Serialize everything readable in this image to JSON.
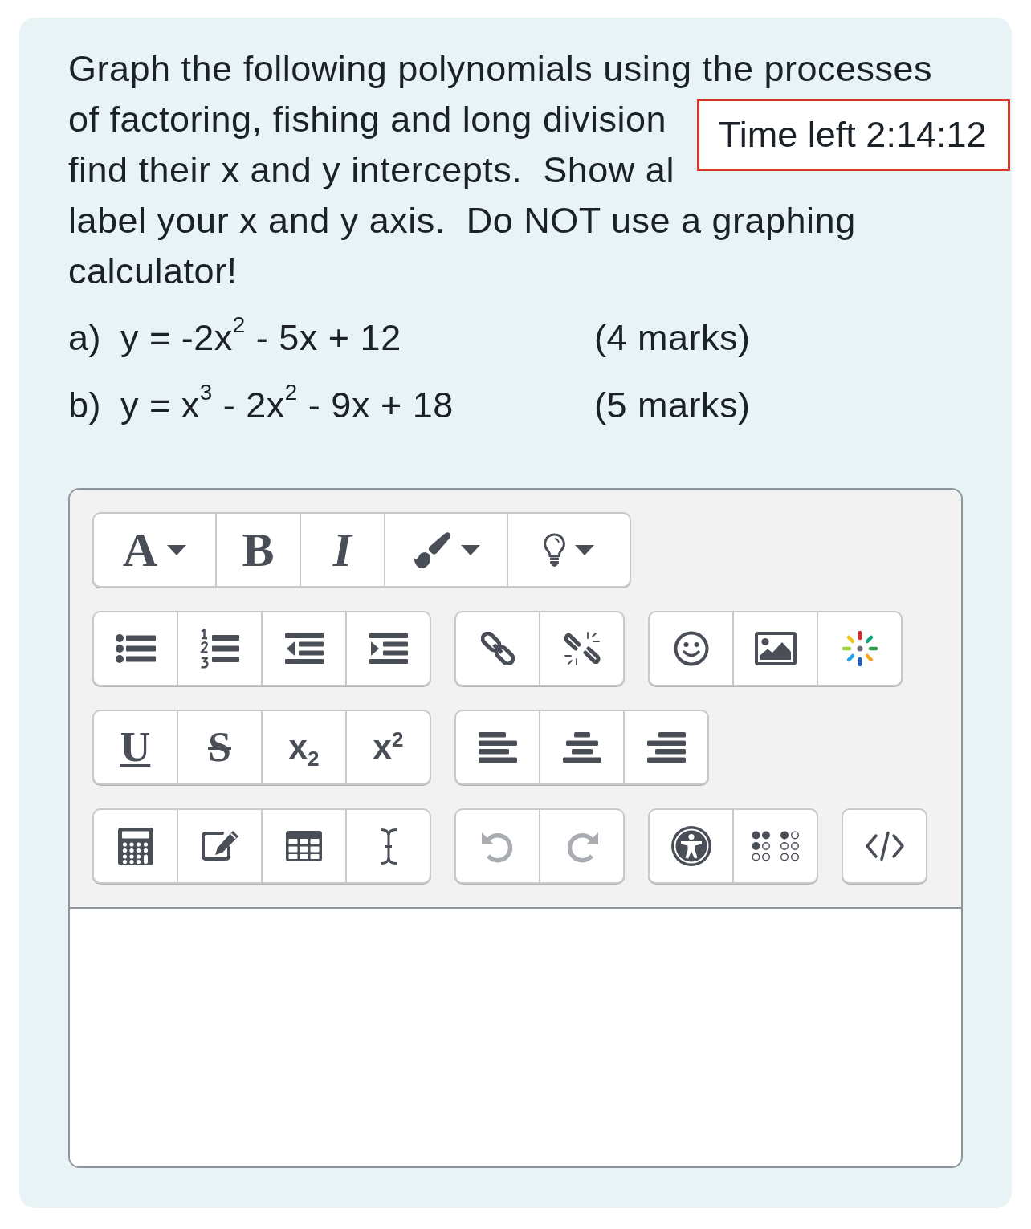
{
  "question": {
    "lines": [
      "Graph the following polynomials using the processes",
      "of factoring, fishing and long division",
      "find their x and y intercepts.  Show al",
      "label your x and y axis.  Do NOT use a graphing",
      "calculator!"
    ]
  },
  "timer": {
    "text": "Time left 2:14:12"
  },
  "parts": [
    {
      "label": "a)",
      "equation": "y = -2x$^{2}$ - 5x + 12",
      "marks": "(4 marks)"
    },
    {
      "label": "b)",
      "equation": "y = x$^{3}$ - 2x$^{2}$ - 9x + 18",
      "marks": "(5 marks)"
    }
  ],
  "editor": {
    "toolbar_rows": [
      [
        [
          {
            "kind": "font",
            "label": "A",
            "dropdown": true,
            "disabled": false
          },
          {
            "kind": "bold",
            "label": "B",
            "disabled": false
          },
          {
            "kind": "italic",
            "label": "I",
            "disabled": false
          },
          {
            "kind": "brush",
            "dropdown": true,
            "disabled": false
          },
          {
            "kind": "bulb",
            "dropdown": true,
            "disabled": false
          }
        ]
      ],
      [
        [
          {
            "kind": "bullets",
            "disabled": false
          },
          {
            "kind": "numbers",
            "disabled": false
          },
          {
            "kind": "outdent",
            "disabled": false
          },
          {
            "kind": "indent",
            "disabled": false
          }
        ],
        [
          {
            "kind": "link",
            "disabled": false
          },
          {
            "kind": "unlink",
            "disabled": false
          }
        ],
        [
          {
            "kind": "emoji",
            "disabled": false
          },
          {
            "kind": "image",
            "disabled": false
          },
          {
            "kind": "media",
            "disabled": false
          }
        ]
      ],
      [
        [
          {
            "kind": "underline",
            "label": "U",
            "disabled": false
          },
          {
            "kind": "strike",
            "label": "S",
            "disabled": false
          },
          {
            "kind": "subscript",
            "label": "x$_{2}$",
            "disabled": false
          },
          {
            "kind": "superscript",
            "label": "x$^{2}$",
            "disabled": false
          }
        ],
        [
          {
            "kind": "align_left",
            "disabled": false
          },
          {
            "kind": "align_center",
            "disabled": false
          },
          {
            "kind": "align_right",
            "disabled": false
          }
        ]
      ],
      [
        [
          {
            "kind": "equation",
            "disabled": false
          },
          {
            "kind": "note",
            "disabled": false
          },
          {
            "kind": "table",
            "disabled": false
          },
          {
            "kind": "cursor",
            "disabled": false
          }
        ],
        [
          {
            "kind": "undo",
            "disabled": true
          },
          {
            "kind": "redo",
            "disabled": true
          }
        ],
        [
          {
            "kind": "accessibility",
            "disabled": false
          },
          {
            "kind": "braille",
            "disabled": false
          }
        ],
        [
          {
            "kind": "html",
            "disabled": false
          }
        ]
      ]
    ]
  }
}
